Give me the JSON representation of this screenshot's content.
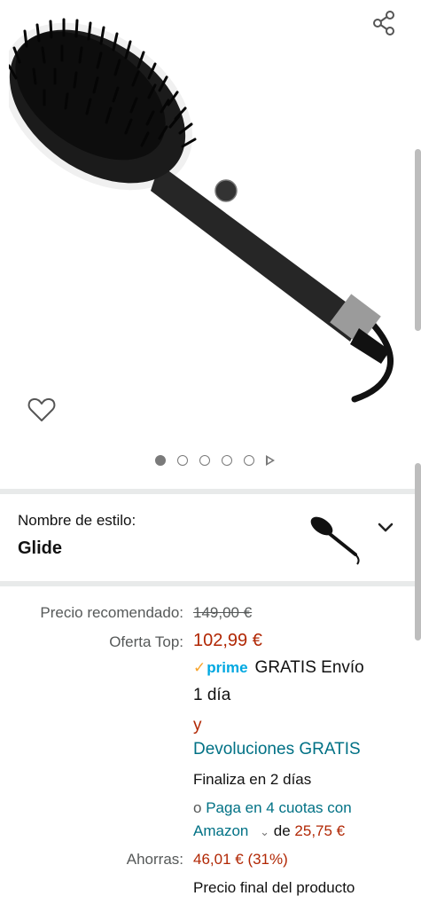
{
  "carousel": {
    "total_images": 5,
    "active_index": 0
  },
  "style": {
    "label": "Nombre de estilo:",
    "value": "Glide"
  },
  "pricing": {
    "rrp_label": "Precio recomendado:",
    "rrp_value": "149,00 €",
    "deal_label": "Oferta Top:",
    "deal_value": "102,99 €",
    "prime_label": "prime",
    "prime_delivery": "GRATIS Envío",
    "delivery_time": "1 día",
    "and_word": "y",
    "returns": "Devoluciones GRATIS",
    "ends_in": "Finaliza en 2 días",
    "installments_prefix": "o",
    "installments_link_1": "Paga en 4 cuotas con",
    "installments_link_2": "Amazon",
    "installments_of": "de",
    "installments_amount": "25,75 €",
    "savings_label": "Ahorras:",
    "savings_value": "46,01 € (31%)",
    "final_price_note": "Precio final del producto"
  },
  "colors": {
    "price_red": "#b12704",
    "link_teal": "#007185",
    "prime_blue": "#00a8e1",
    "prime_check": "#f7a42c",
    "divider_grey": "#e8eaea"
  },
  "icons": {
    "share": "share-icon",
    "wishlist": "heart-outline-icon",
    "expand": "chevron-down-icon",
    "carousel_video": "play-icon"
  }
}
